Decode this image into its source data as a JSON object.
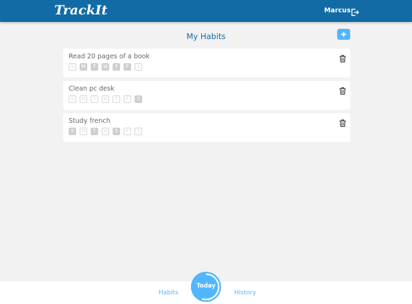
{
  "header": {
    "logo": "TrackIt",
    "username": "Marcus",
    "logout_icon": "logout-icon"
  },
  "main": {
    "title": "My Habits",
    "add_button_icon": "plus-icon",
    "habits": [
      {
        "name": "Read 20 pages of a book",
        "days": [
          {
            "label": "S",
            "selected": false
          },
          {
            "label": "M",
            "selected": true
          },
          {
            "label": "T",
            "selected": true
          },
          {
            "label": "W",
            "selected": true
          },
          {
            "label": "T",
            "selected": true
          },
          {
            "label": "F",
            "selected": true
          },
          {
            "label": "S",
            "selected": false
          }
        ]
      },
      {
        "name": "Clean pc desk",
        "days": [
          {
            "label": "S",
            "selected": false
          },
          {
            "label": "M",
            "selected": false
          },
          {
            "label": "T",
            "selected": false
          },
          {
            "label": "W",
            "selected": false
          },
          {
            "label": "T",
            "selected": false
          },
          {
            "label": "F",
            "selected": false
          },
          {
            "label": "S",
            "selected": true
          }
        ]
      },
      {
        "name": "Study french",
        "days": [
          {
            "label": "S",
            "selected": true
          },
          {
            "label": "M",
            "selected": false
          },
          {
            "label": "T",
            "selected": true
          },
          {
            "label": "W",
            "selected": false
          },
          {
            "label": "T",
            "selected": true
          },
          {
            "label": "F",
            "selected": false
          },
          {
            "label": "S",
            "selected": false
          }
        ]
      }
    ]
  },
  "footer": {
    "habits_label": "Habits",
    "today_label": "Today",
    "history_label": "History"
  },
  "colors": {
    "header": "#126ba5",
    "accent": "#52b6ff",
    "background": "#f2f2f2",
    "day_selected": "#cfcfcf"
  }
}
